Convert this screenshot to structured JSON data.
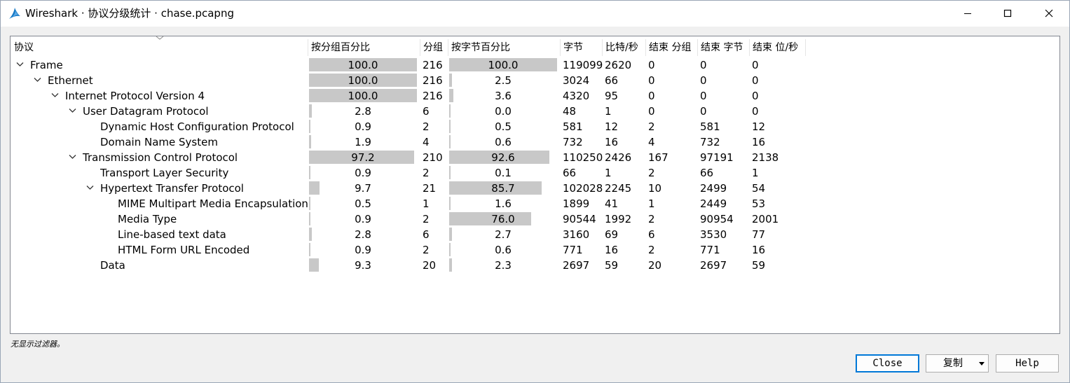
{
  "window": {
    "title": "Wireshark · 协议分级统计 · chase.pcapng",
    "icon": "wireshark-fin-icon",
    "accent": "#0078d7"
  },
  "columns": [
    "协议",
    "按分组百分比",
    "分组",
    "按字节百分比",
    "字节",
    "比特/秒",
    "结束 分组",
    "结束 字节",
    "结束 位/秒"
  ],
  "rows": [
    {
      "name": "Frame",
      "level": 0,
      "expanded": true,
      "pkt_pct": "100.0",
      "pkt_pct_value": 100.0,
      "packets": "216",
      "byte_pct": "100.0",
      "byte_pct_value": 100.0,
      "bytes": "119099",
      "bits_s": "2620",
      "end_pkts": "0",
      "end_bytes": "0",
      "end_bits_s": "0"
    },
    {
      "name": "Ethernet",
      "level": 1,
      "expanded": true,
      "pkt_pct": "100.0",
      "pkt_pct_value": 100.0,
      "packets": "216",
      "byte_pct": "2.5",
      "byte_pct_value": 2.5,
      "bytes": "3024",
      "bits_s": "66",
      "end_pkts": "0",
      "end_bytes": "0",
      "end_bits_s": "0"
    },
    {
      "name": "Internet Protocol Version 4",
      "level": 2,
      "expanded": true,
      "pkt_pct": "100.0",
      "pkt_pct_value": 100.0,
      "packets": "216",
      "byte_pct": "3.6",
      "byte_pct_value": 3.6,
      "bytes": "4320",
      "bits_s": "95",
      "end_pkts": "0",
      "end_bytes": "0",
      "end_bits_s": "0"
    },
    {
      "name": "User Datagram Protocol",
      "level": 3,
      "expanded": true,
      "pkt_pct": "2.8",
      "pkt_pct_value": 2.8,
      "packets": "6",
      "byte_pct": "0.0",
      "byte_pct_value": 0.0,
      "bytes": "48",
      "bits_s": "1",
      "end_pkts": "0",
      "end_bytes": "0",
      "end_bits_s": "0"
    },
    {
      "name": "Dynamic Host Configuration Protocol",
      "level": 4,
      "expanded": null,
      "pkt_pct": "0.9",
      "pkt_pct_value": 0.9,
      "packets": "2",
      "byte_pct": "0.5",
      "byte_pct_value": 0.5,
      "bytes": "581",
      "bits_s": "12",
      "end_pkts": "2",
      "end_bytes": "581",
      "end_bits_s": "12"
    },
    {
      "name": "Domain Name System",
      "level": 4,
      "expanded": null,
      "pkt_pct": "1.9",
      "pkt_pct_value": 1.9,
      "packets": "4",
      "byte_pct": "0.6",
      "byte_pct_value": 0.6,
      "bytes": "732",
      "bits_s": "16",
      "end_pkts": "4",
      "end_bytes": "732",
      "end_bits_s": "16"
    },
    {
      "name": "Transmission Control Protocol",
      "level": 3,
      "expanded": true,
      "pkt_pct": "97.2",
      "pkt_pct_value": 97.2,
      "packets": "210",
      "byte_pct": "92.6",
      "byte_pct_value": 92.6,
      "bytes": "110250",
      "bits_s": "2426",
      "end_pkts": "167",
      "end_bytes": "97191",
      "end_bits_s": "2138"
    },
    {
      "name": "Transport Layer Security",
      "level": 4,
      "expanded": null,
      "pkt_pct": "0.9",
      "pkt_pct_value": 0.9,
      "packets": "2",
      "byte_pct": "0.1",
      "byte_pct_value": 0.1,
      "bytes": "66",
      "bits_s": "1",
      "end_pkts": "2",
      "end_bytes": "66",
      "end_bits_s": "1"
    },
    {
      "name": "Hypertext Transfer Protocol",
      "level": 4,
      "expanded": true,
      "pkt_pct": "9.7",
      "pkt_pct_value": 9.7,
      "packets": "21",
      "byte_pct": "85.7",
      "byte_pct_value": 85.7,
      "bytes": "102028",
      "bits_s": "2245",
      "end_pkts": "10",
      "end_bytes": "2499",
      "end_bits_s": "54"
    },
    {
      "name": "MIME Multipart Media Encapsulation",
      "level": 5,
      "expanded": null,
      "pkt_pct": "0.5",
      "pkt_pct_value": 0.5,
      "packets": "1",
      "byte_pct": "1.6",
      "byte_pct_value": 1.6,
      "bytes": "1899",
      "bits_s": "41",
      "end_pkts": "1",
      "end_bytes": "2449",
      "end_bits_s": "53"
    },
    {
      "name": "Media Type",
      "level": 5,
      "expanded": null,
      "pkt_pct": "0.9",
      "pkt_pct_value": 0.9,
      "packets": "2",
      "byte_pct": "76.0",
      "byte_pct_value": 76.0,
      "bytes": "90544",
      "bits_s": "1992",
      "end_pkts": "2",
      "end_bytes": "90954",
      "end_bits_s": "2001"
    },
    {
      "name": "Line-based text data",
      "level": 5,
      "expanded": null,
      "pkt_pct": "2.8",
      "pkt_pct_value": 2.8,
      "packets": "6",
      "byte_pct": "2.7",
      "byte_pct_value": 2.7,
      "bytes": "3160",
      "bits_s": "69",
      "end_pkts": "6",
      "end_bytes": "3530",
      "end_bits_s": "77"
    },
    {
      "name": "HTML Form URL Encoded",
      "level": 5,
      "expanded": null,
      "pkt_pct": "0.9",
      "pkt_pct_value": 0.9,
      "packets": "2",
      "byte_pct": "0.6",
      "byte_pct_value": 0.6,
      "bytes": "771",
      "bits_s": "16",
      "end_pkts": "2",
      "end_bytes": "771",
      "end_bits_s": "16"
    },
    {
      "name": "Data",
      "level": 4,
      "expanded": null,
      "pkt_pct": "9.3",
      "pkt_pct_value": 9.3,
      "packets": "20",
      "byte_pct": "2.3",
      "byte_pct_value": 2.3,
      "bytes": "2697",
      "bits_s": "59",
      "end_pkts": "20",
      "end_bytes": "2697",
      "end_bits_s": "59"
    }
  ],
  "status": "无显示过滤器。",
  "buttons": {
    "close": "Close",
    "copy": "复制",
    "help": "Help"
  },
  "colors": {
    "bar": "#c8c8c8",
    "panel_border": "#828790",
    "default_button_border": "#0078d7"
  }
}
